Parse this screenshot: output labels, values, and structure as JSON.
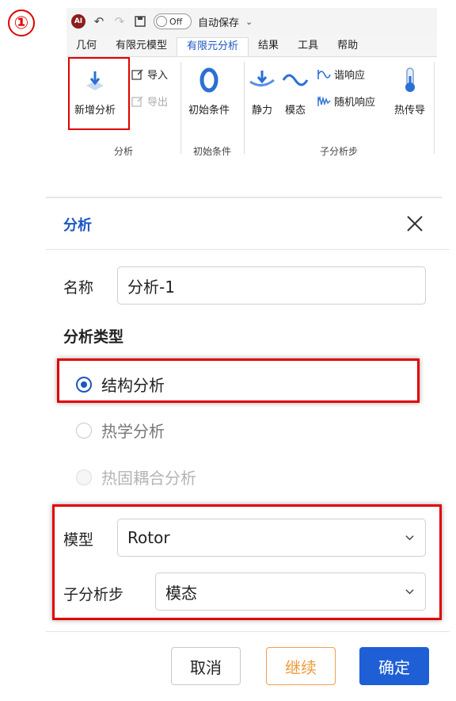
{
  "step_number": "①",
  "quick_access": {
    "logo_text": "AI",
    "toggle_label": "Off",
    "autosave_label": "自动保存"
  },
  "ribbon": {
    "tabs": [
      {
        "label": "几何",
        "active": false
      },
      {
        "label": "有限元模型",
        "active": false
      },
      {
        "label": "有限元分析",
        "active": true
      },
      {
        "label": "结果",
        "active": false
      },
      {
        "label": "工具",
        "active": false
      },
      {
        "label": "帮助",
        "active": false
      }
    ],
    "new_analysis": "新增分析",
    "import": "导入",
    "export": "导出",
    "initial_conditions": "初始条件",
    "static": "静力",
    "modal": "模态",
    "harmonic": "谐响应",
    "random_response": "随机响应",
    "heat_conduction": "热传导",
    "groups": [
      "分析",
      "初始条件",
      "子分析步"
    ]
  },
  "dialog": {
    "title": "分析",
    "name_label": "名称",
    "name_value": "分析-1",
    "type_section_title": "分析类型",
    "types": [
      {
        "label": "结构分析",
        "state": "checked"
      },
      {
        "label": "热学分析",
        "state": "unchecked"
      },
      {
        "label": "热固耦合分析",
        "state": "disabled"
      }
    ],
    "model_label": "模型",
    "model_value": "Rotor",
    "substep_label": "子分析步",
    "substep_value": "模态",
    "buttons": {
      "cancel": "取消",
      "continue": "继续",
      "ok": "确定"
    }
  },
  "colors": {
    "accent": "#1a56c4",
    "highlight": "#e00000",
    "continue": "#f09a3a"
  }
}
